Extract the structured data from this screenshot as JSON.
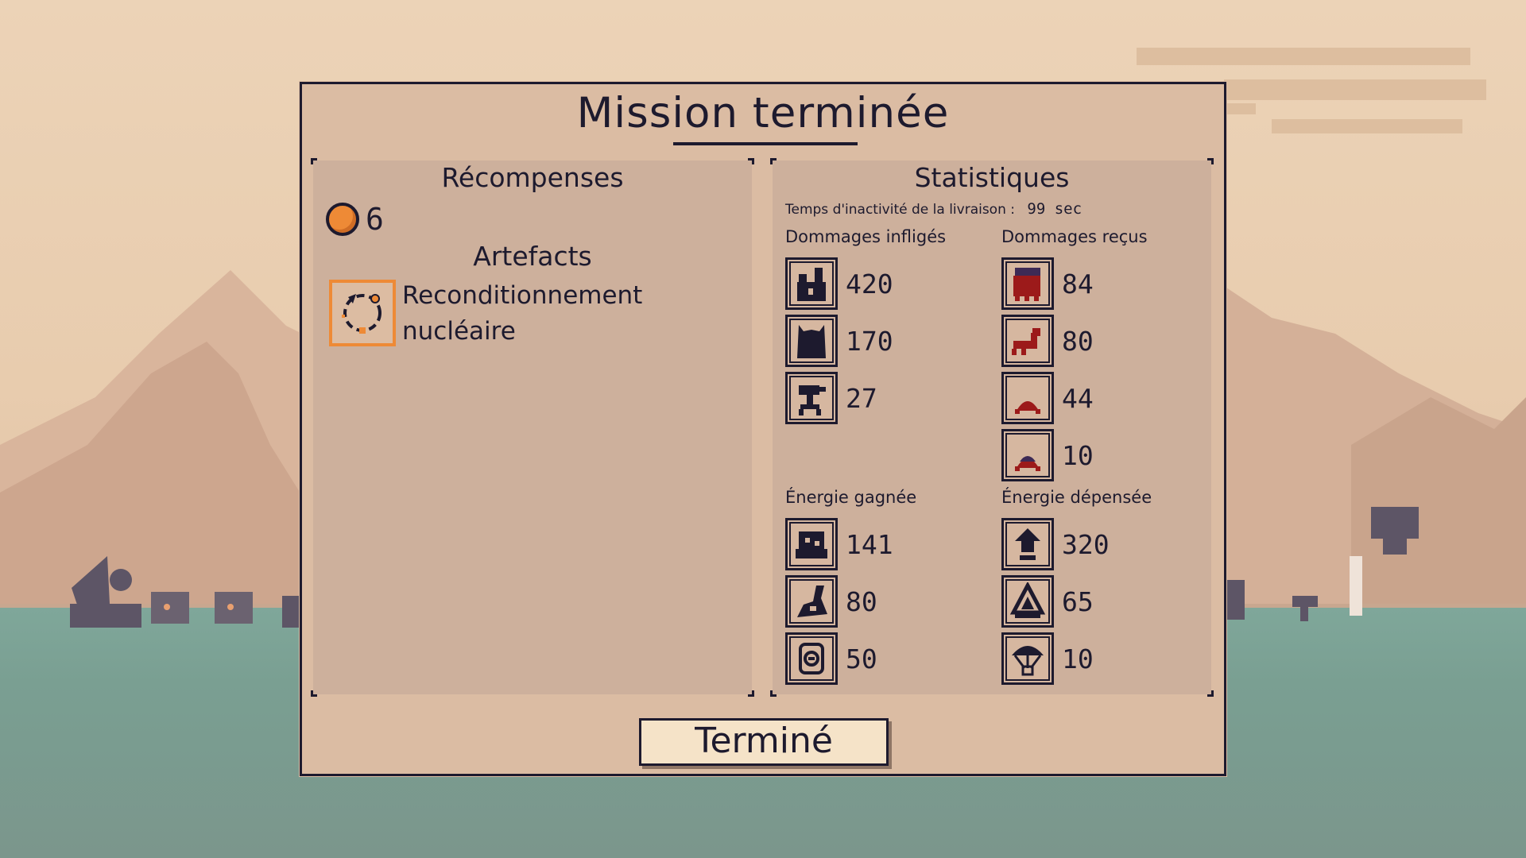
{
  "dialog": {
    "title": "Mission terminée"
  },
  "rewards": {
    "title": "Récompenses",
    "coins": "6",
    "artifacts_title": "Artefacts",
    "artifact_name_line1": "Reconditionnement",
    "artifact_name_line2": "nucléaire"
  },
  "stats": {
    "title": "Statistiques",
    "idle_label": "Temps d'inactivité de la livraison :",
    "idle_value": "99 sec",
    "damage_dealt_label": "Dommages infligés",
    "damage_taken_label": "Dommages reçus",
    "energy_gained_label": "Énergie gagnée",
    "energy_spent_label": "Énergie dépensée",
    "damage_dealt": [
      {
        "icon": "castle-icon",
        "value": "420"
      },
      {
        "icon": "tower-icon",
        "value": "170"
      },
      {
        "icon": "turret-icon",
        "value": "27"
      }
    ],
    "damage_taken": [
      {
        "icon": "red-beast-icon",
        "value": "84"
      },
      {
        "icon": "scorpion-icon",
        "value": "80"
      },
      {
        "icon": "crawler-icon",
        "value": "44"
      },
      {
        "icon": "shelled-crawler-icon",
        "value": "10"
      }
    ],
    "energy_gained": [
      {
        "icon": "generator-icon",
        "value": "141"
      },
      {
        "icon": "harvester-icon",
        "value": "80"
      },
      {
        "icon": "battery-icon",
        "value": "50"
      }
    ],
    "energy_spent": [
      {
        "icon": "upgrade-icon",
        "value": "320"
      },
      {
        "icon": "shield-icon",
        "value": "65"
      },
      {
        "icon": "parachute-icon",
        "value": "10"
      }
    ]
  },
  "buttons": {
    "done_label": "Terminé"
  },
  "colors": {
    "ink": "#1d1a2e",
    "panel": "#cdb09c",
    "dialog": "#dbbca3",
    "coin": "#ee8a36",
    "enemy_red": "#9c1a1a",
    "sea": "#7fa79a"
  }
}
